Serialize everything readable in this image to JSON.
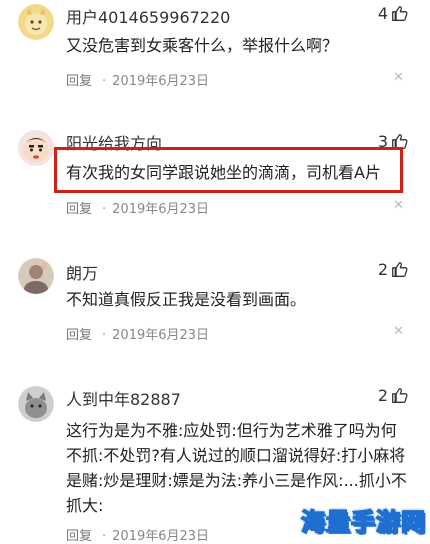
{
  "comments": [
    {
      "username": "用户4014659967220",
      "likes": "4",
      "text": "又没危害到女乘客什么，举报什么啊？",
      "reply_label": "回复",
      "date": "2019年6月23日",
      "avatar": "yellow-cartoon-avatar"
    },
    {
      "username": "阳光给我方向",
      "likes": "3",
      "text": "有次我的女同学跟说她坐的滴滴，司机看A片",
      "reply_label": "回复",
      "date": "2019年6月23日",
      "avatar": "crayon-shin-chan-avatar",
      "highlight_color": "#d0201a"
    },
    {
      "username": "朗万",
      "likes": "2",
      "text": "不知道真假反正我是没看到画面。",
      "reply_label": "回复",
      "date": "2019年6月23日",
      "avatar": "photo-avatar"
    },
    {
      "username": "人到中年82887",
      "likes": "2",
      "text": "这行为是为不雅:应处罚:但行为艺术雅了吗为何不抓:不处罚?有人说过的顺口溜说得好:打小麻将是赌:炒是理财:嫖是为法:养小三是作风:...抓小不抓大:",
      "reply_label": "回复",
      "date": "2019年6月23日",
      "avatar": "cat-avatar"
    }
  ],
  "watermark": "海量手游网",
  "colors": {
    "highlight": "#d0201a",
    "watermark": "#1e6fd0",
    "meta": "#888888"
  }
}
